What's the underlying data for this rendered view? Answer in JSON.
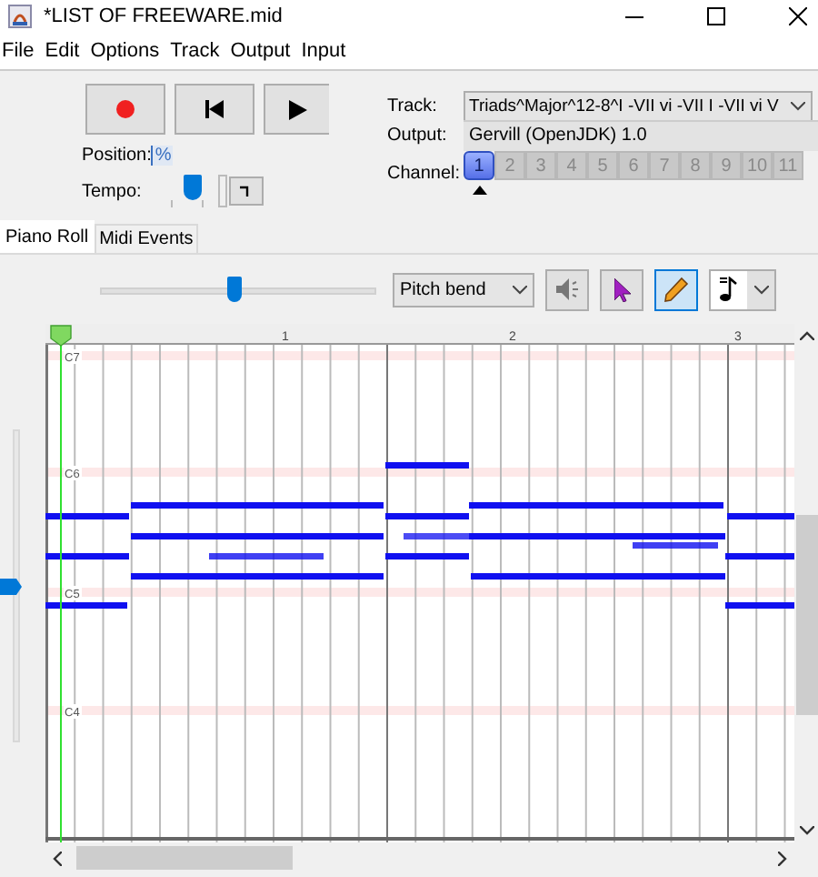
{
  "window": {
    "title": "*LIST OF FREEWARE.mid"
  },
  "menu": [
    "File",
    "Edit",
    "Options",
    "Track",
    "Output",
    "Input"
  ],
  "position": {
    "label": "Position:",
    "value": "%"
  },
  "tempo": {
    "label": "Tempo:",
    "level": 0.5
  },
  "track": {
    "label": "Track:",
    "value": "Triads^Major^12-8^I -VII vi -VII I -VII vi V"
  },
  "output": {
    "label": "Output:",
    "value": "Gervill (OpenJDK) 1.0"
  },
  "channel": {
    "label": "Channel:",
    "items": [
      {
        "label": "1",
        "selected": true
      },
      {
        "label": "2",
        "selected": false
      },
      {
        "label": "3",
        "selected": false
      },
      {
        "label": "4",
        "selected": false
      },
      {
        "label": "5",
        "selected": false
      },
      {
        "label": "6",
        "selected": false
      },
      {
        "label": "7",
        "selected": false
      },
      {
        "label": "8",
        "selected": false
      },
      {
        "label": "9",
        "selected": false
      },
      {
        "label": "10",
        "selected": false
      },
      {
        "label": "11",
        "selected": false
      }
    ]
  },
  "tabs": [
    {
      "label": "Piano Roll",
      "selected": true
    },
    {
      "label": "Midi Events",
      "selected": false
    }
  ],
  "zoom_slider": {
    "level": 0.5
  },
  "controller": {
    "value": "Pitch bend"
  },
  "tools": [
    {
      "kind": "speaker",
      "selected": false
    },
    {
      "kind": "pointer",
      "selected": false
    },
    {
      "kind": "pencil",
      "selected": true
    }
  ],
  "piano_roll": {
    "measures": [
      "1",
      "2",
      "3"
    ],
    "octaves": [
      "C7",
      "C6",
      "C5",
      "C4"
    ],
    "velocity": {
      "level": 0.5
    }
  }
}
